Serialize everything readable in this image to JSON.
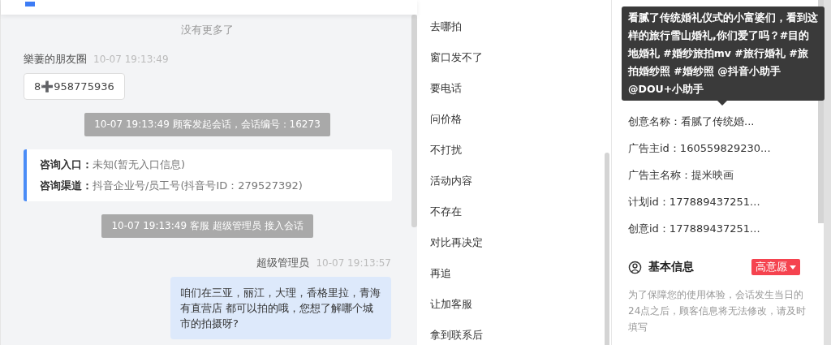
{
  "chat": {
    "no_more": "没有更多了",
    "messages": [
      {
        "kind": "incoming",
        "sender": "樂萋的朋友圈",
        "time": "10-07 19:13:49",
        "text": "8➕958775936"
      },
      {
        "kind": "system",
        "text": "10-07 19:13:49 顾客发起会话，会话编号：16273"
      },
      {
        "kind": "info",
        "rows": [
          {
            "label": "咨询入口：",
            "value": "未知(暂无入口信息)"
          },
          {
            "label": "咨询渠道：",
            "value": "抖音企业号/员工号(抖音号ID：279527392)"
          }
        ]
      },
      {
        "kind": "system",
        "text": "10-07 19:13:49 客服 超级管理员 接入会话"
      },
      {
        "kind": "outgoing",
        "sender": "超级管理员",
        "time": "10-07 19:13:57",
        "text": "咱们在三亚，丽江，大理，香格里拉，青海有直营店 都可以拍的哦，您想了解哪个城市的拍摄呀?"
      }
    ]
  },
  "quick_replies": [
    "去哪拍",
    "窗口发不了",
    "要电话",
    "问价格",
    "不打扰",
    "活动内容",
    "不存在",
    "对比再决定",
    "再追",
    "让加客服",
    "拿到联系后"
  ],
  "details": {
    "tooltip": "看腻了传统婚礼仪式的小富婆们，看到这样的旅行雪山婚礼,你们爱了吗？#目的地婚礼 #婚纱旅拍mv #旅行婚礼 #旅拍婚纱照 #婚纱照 @抖音小助手 @DOU+小助手",
    "rows": [
      "创意名称：看腻了传统婚...",
      "广告主id：160559829230...",
      "广告主名称：提米映画",
      "计划id：177889437251...",
      "创意id：177889437251..."
    ],
    "section": {
      "title": "基本信息",
      "tag": "高意愿",
      "hint": "为了保障您的使用体验，会话发生当日的24点之后，顾客信息将无法修改，请及时填写"
    }
  }
}
